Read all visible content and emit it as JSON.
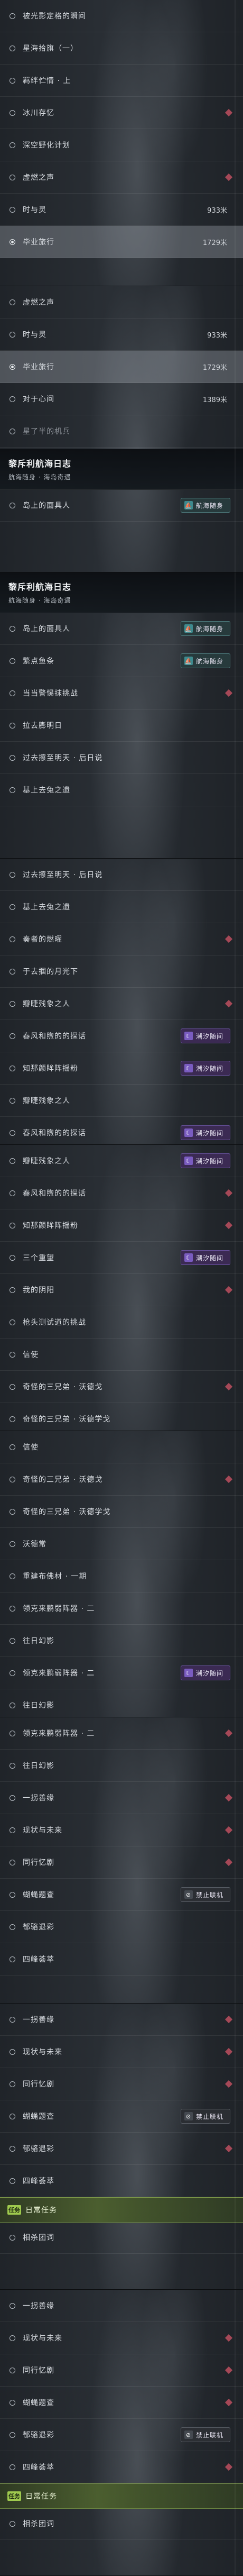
{
  "texts": {
    "l01": "被光影定格的瞬间",
    "l02": "星海拾旗（一）",
    "l03": "羁绊伫情 · 上",
    "l04": "冰川存忆",
    "l05": "深空野化计划",
    "l06": "虚燃之声",
    "l07": "时与灵",
    "l08": "毕业旅行",
    "l09": "对于心间",
    "l10": "星了半的机兵",
    "l11": "岛上的面具人",
    "l12": "繁点鱼条",
    "l13": "当当警惕抹挑战",
    "l14": "拉去膨明日",
    "l15": "过去擦至明天 · 后日说",
    "l16": "基上去兔之遗",
    "l17": "奏者的燃曜",
    "l18": "于去掴的月光下",
    "l19": "瓣睫残象之人",
    "l20": "春风和煦的的探话",
    "l21": "知那颜眸阵摇粉",
    "l22": "三个重望",
    "l23": "我的阴阳",
    "l24": "枪头测试道的挑战",
    "l25": "信使",
    "l26": "奇怪的三兄弟 · 沃德戈",
    "l27": "奇怪的三兄弟 · 沃德学戈",
    "l28": "沃德常",
    "l29": "重建布佛材 · 一期",
    "l30": "领克来鹏弱阵器 · 二",
    "l31": "往日幻影",
    "l32": "一拐善缘",
    "l33": "现状与未来",
    "l34": "同行忆剧",
    "l35": "蝴蝇题查",
    "l36": "郁骆退彩",
    "l37": "四峰荟萃",
    "l38": "相杀团词",
    "d933": "933米",
    "d1729": "1729米",
    "d1389": "1389米",
    "header_title": "黎斥利航海日志",
    "header_sub": "航海随身 · 海岛奇遇",
    "badge_sea": "航海随身",
    "badge_glow": "潮汐随间",
    "badge_ban": "禁止联机",
    "daily": "日常任务",
    "daily_icon": "任务"
  },
  "colors": {
    "accent": "#9fca4e",
    "marker": "#b44c5c",
    "badge_purple": "#3b2a53",
    "badge_teal": "#273a3c"
  },
  "icons": {
    "marker": "diamond-marker-icon",
    "badge_sea": "ship-icon",
    "badge_glow": "crescent-icon",
    "badge_ban": "no-link-icon"
  },
  "panels": [
    {
      "rows": [
        {
          "t": "l01"
        },
        {
          "t": "l02"
        },
        {
          "t": "l03"
        },
        {
          "t": "l04",
          "m": true
        },
        {
          "t": "l05"
        },
        {
          "t": "l06",
          "m": true
        },
        {
          "t": "l07",
          "d": "d933"
        },
        {
          "t": "l08",
          "d": "d1729",
          "sel": true
        }
      ]
    },
    {
      "rows": [
        {
          "t": "l06"
        },
        {
          "t": "l07",
          "d": "d933"
        },
        {
          "t": "l08",
          "d": "d1729",
          "sel": true
        },
        {
          "t": "l09",
          "d": "d1389"
        },
        {
          "t": "l10",
          "f": true
        }
      ],
      "header": true,
      "headerRows": [
        {
          "t": "l11",
          "b": "badge_sea"
        }
      ]
    },
    {
      "header": true,
      "rows": [
        {
          "t": "l11",
          "b": "badge_sea"
        },
        {
          "t": "l12",
          "b": "badge_sea"
        },
        {
          "t": "l13",
          "m": true
        },
        {
          "t": "l14"
        },
        {
          "t": "l15"
        },
        {
          "t": "l16"
        }
      ]
    },
    {
      "rows": [
        {
          "t": "l15"
        },
        {
          "t": "l16"
        },
        {
          "t": "l17",
          "m": true
        },
        {
          "t": "l18"
        },
        {
          "t": "l19",
          "m": true
        },
        {
          "t": "l20",
          "b": "badge_glow"
        },
        {
          "t": "l21",
          "b": "badge_glow"
        },
        {
          "t": "l19"
        },
        {
          "t": "l20",
          "b": "badge_glow"
        }
      ]
    },
    {
      "rows": [
        {
          "t": "l19",
          "b": "badge_glow"
        },
        {
          "t": "l20",
          "m": true
        },
        {
          "t": "l21",
          "m": true
        },
        {
          "t": "l22",
          "b": "badge_glow"
        },
        {
          "t": "l23",
          "m": true
        },
        {
          "t": "l24"
        },
        {
          "t": "l25"
        },
        {
          "t": "l26",
          "m": true
        },
        {
          "t": "l27"
        }
      ]
    },
    {
      "rows": [
        {
          "t": "l25"
        },
        {
          "t": "l26",
          "m": true
        },
        {
          "t": "l27"
        },
        {
          "t": "l28"
        },
        {
          "t": "l29"
        },
        {
          "t": "l30"
        },
        {
          "t": "l31"
        },
        {
          "t": "l30",
          "b": "badge_glow"
        },
        {
          "t": "l31"
        }
      ]
    },
    {
      "rows": [
        {
          "t": "l30",
          "m": true
        },
        {
          "t": "l31"
        },
        {
          "t": "l32",
          "m": true
        },
        {
          "t": "l33",
          "m": true
        },
        {
          "t": "l34",
          "m": true
        },
        {
          "t": "l35",
          "b": "badge_ban"
        },
        {
          "t": "l36"
        },
        {
          "t": "l37"
        }
      ]
    },
    {
      "rows": [
        {
          "t": "l32",
          "m": true
        },
        {
          "t": "l33",
          "m": true
        },
        {
          "t": "l34",
          "m": true
        },
        {
          "t": "l35",
          "b": "badge_ban"
        },
        {
          "t": "l36",
          "m": true
        },
        {
          "t": "l37"
        }
      ],
      "daily": true,
      "dailyRows": [
        {
          "t": "l38"
        }
      ]
    },
    {
      "rows": [
        {
          "t": "l32"
        },
        {
          "t": "l33",
          "m": true
        },
        {
          "t": "l34",
          "m": true
        },
        {
          "t": "l35",
          "m": true
        },
        {
          "t": "l36",
          "b": "badge_ban"
        },
        {
          "t": "l37",
          "m": true
        }
      ],
      "daily": true,
      "dailyRows": [
        {
          "t": "l38"
        }
      ]
    }
  ]
}
